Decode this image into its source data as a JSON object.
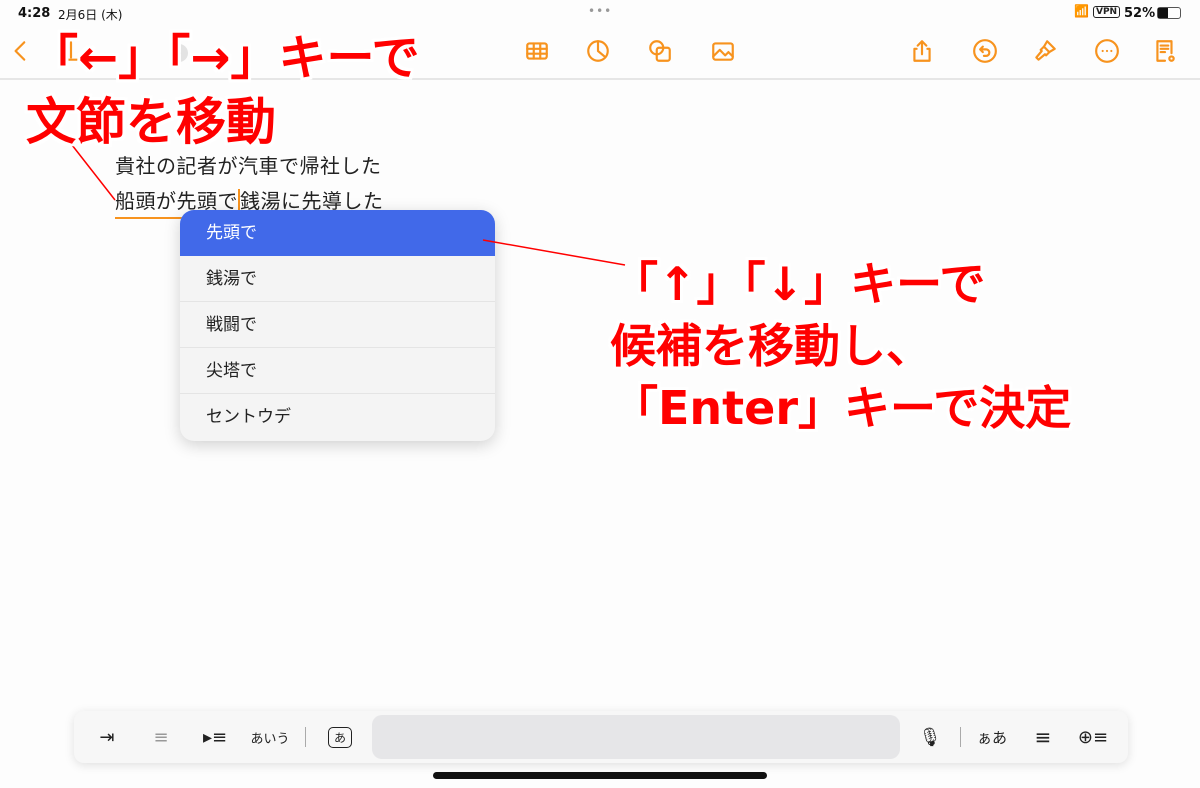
{
  "status": {
    "time": "4:28",
    "date": "2月6日 (木)",
    "vpn": "VPN",
    "battery": "52%"
  },
  "toolbar": {
    "icons": [
      "back-icon",
      "text-format-icon",
      "chevron-down-icon",
      "table-icon",
      "chart-icon",
      "shapes-icon",
      "media-icon",
      "share-icon",
      "undo-icon",
      "brush-icon",
      "more-icon",
      "reader-icon"
    ]
  },
  "document": {
    "line1": "貴社の記者が汽車で帰社した",
    "line2_a": "船頭が先頭で",
    "line2_b": "銭湯に先導した"
  },
  "candidates": [
    "先頭で",
    "銭湯で",
    "戦闘で",
    "尖塔で",
    "セントウデ"
  ],
  "annotations": {
    "left_line1": "「←」「→」キーで",
    "left_line2": "文節を移動",
    "right_line1": "「↑」「↓」キーで",
    "right_line2": "候補を移動し、",
    "right_line3": "「Enter」キーで決定"
  },
  "keyboard_bar": {
    "kana_label": "あいう",
    "kana_box": "あ",
    "script_label": "ぁあ"
  },
  "colors": {
    "accent": "#f7931e",
    "selection": "#4169e9",
    "annotation": "#ff0000"
  }
}
